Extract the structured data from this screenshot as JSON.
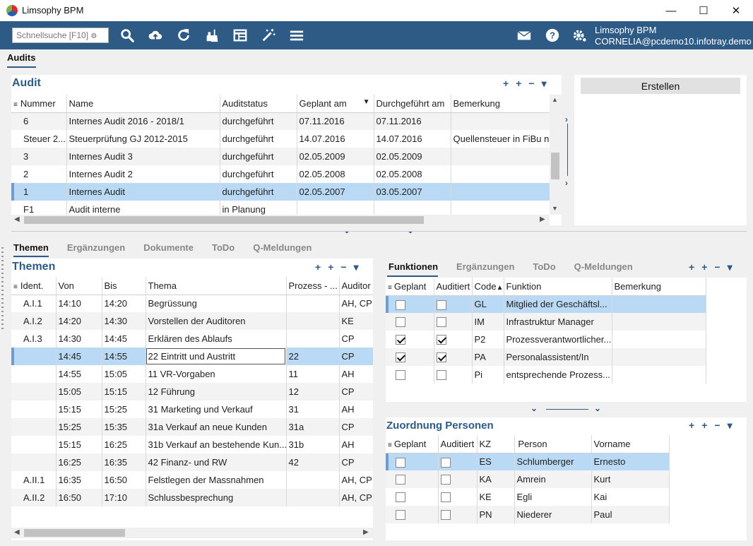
{
  "window": {
    "title": "Limsophy BPM",
    "minimize": "—",
    "maximize": "☐",
    "close": "✕"
  },
  "toolbar": {
    "search_placeholder": "Schnellsuche [F10]",
    "user_app": "Limsophy BPM",
    "user_email": "CORNELIA@pcdemo10.infotray.demo"
  },
  "main_tab": "Audits",
  "audit": {
    "title": "Audit",
    "create_label": "Erstellen",
    "columns": [
      "Nummer",
      "Name",
      "Auditstatus",
      "Geplant am",
      "Durchgeführt am",
      "Bemerkung"
    ],
    "rows": [
      [
        "6",
        "Internes Audit 2016 - 2018/1",
        "durchgeführt",
        "07.11.2016",
        "07.11.2016",
        ""
      ],
      [
        "Steuer 2...",
        "Steuerprüfung GJ 2012-2015",
        "durchgeführt",
        "14.07.2016",
        "14.07.2016",
        "Quellensteuer in FiBu na"
      ],
      [
        "3",
        "Internes Audit 3",
        "durchgeführt",
        "02.05.2009",
        "02.05.2009",
        ""
      ],
      [
        "2",
        "Internes Audit 2",
        "durchgeführt",
        "02.05.2008",
        "02.05.2008",
        ""
      ],
      [
        "1",
        "Internes Audit",
        "durchgeführt",
        "02.05.2007",
        "03.05.2007",
        ""
      ],
      [
        "F1",
        "Audit interne",
        "in Planung",
        "",
        "",
        ""
      ]
    ],
    "selected_row": 4
  },
  "lower_tabs": [
    "Themen",
    "Ergänzungen",
    "Dokumente",
    "ToDo",
    "Q-Meldungen"
  ],
  "themen": {
    "title": "Themen",
    "columns": [
      "Ident.",
      "Von",
      "Bis",
      "Thema",
      "Prozess - ...",
      "Auditor"
    ],
    "rows": [
      [
        "A.I.1",
        "14:10",
        "14:20",
        "Begrüssung",
        "",
        "AH, CP"
      ],
      [
        "A.I.2",
        "14:20",
        "14:30",
        "Vorstellen der Auditoren",
        "",
        "KE"
      ],
      [
        "A.I.3",
        "14:30",
        "14:45",
        "Erklären des Ablaufs",
        "",
        "CP"
      ],
      [
        "",
        "14:45",
        "14:55",
        "22 Eintritt und Austritt",
        "22",
        "CP"
      ],
      [
        "",
        "14:55",
        "15:05",
        "11 VR-Vorgaben",
        "11",
        "AH"
      ],
      [
        "",
        "15:05",
        "15:15",
        "12 Führung",
        "12",
        "CP"
      ],
      [
        "",
        "15:15",
        "15:25",
        "31 Marketing und Verkauf",
        "31",
        "AH"
      ],
      [
        "",
        "15:25",
        "15:35",
        "31a Verkauf an neue Kunden",
        "31a",
        "CP"
      ],
      [
        "",
        "15:15",
        "16:25",
        "31b Verkauf an bestehende Kun...",
        "31b",
        "AH"
      ],
      [
        "",
        "16:25",
        "16:35",
        "42 Finanz- und RW",
        "42",
        "CP"
      ],
      [
        "A.II.1",
        "16:35",
        "16:50",
        "Felstlegen der Massnahmen",
        "",
        "AH, CP"
      ],
      [
        "A.II.2",
        "16:50",
        "17:10",
        "Schlussbesprechung",
        "",
        "AH, CP"
      ]
    ],
    "selected_row": 3
  },
  "right_tabs": [
    "Funktionen",
    "Ergänzungen",
    "ToDo",
    "Q-Meldungen"
  ],
  "funktionen": {
    "columns": [
      "Geplant",
      "Auditiert",
      "Code",
      "Funktion",
      "Bemerkung"
    ],
    "rows": [
      {
        "geplant": false,
        "auditiert": false,
        "code": "GL",
        "funktion": "Mitglied der Geschäftsl...",
        "bem": ""
      },
      {
        "geplant": false,
        "auditiert": false,
        "code": "IM",
        "funktion": "Infrastruktur Manager",
        "bem": ""
      },
      {
        "geplant": true,
        "auditiert": true,
        "code": "P2",
        "funktion": "Prozessverantwortlicher...",
        "bem": ""
      },
      {
        "geplant": true,
        "auditiert": true,
        "code": "PA",
        "funktion": "Personalassistent/In",
        "bem": ""
      },
      {
        "geplant": false,
        "auditiert": false,
        "code": "Pi",
        "funktion": "entsprechende Prozess...",
        "bem": ""
      }
    ],
    "selected_row": 0
  },
  "personen": {
    "title": "Zuordnung Personen",
    "columns": [
      "Geplant",
      "Auditiert",
      "KZ",
      "Person",
      "Vorname"
    ],
    "rows": [
      {
        "geplant": false,
        "auditiert": false,
        "kz": "ES",
        "person": "Schlumberger",
        "vorname": "Ernesto"
      },
      {
        "geplant": false,
        "auditiert": false,
        "kz": "KA",
        "person": "Amrein",
        "vorname": "Kurt"
      },
      {
        "geplant": false,
        "auditiert": false,
        "kz": "KE",
        "person": "Egli",
        "vorname": "Kai"
      },
      {
        "geplant": false,
        "auditiert": false,
        "kz": "PN",
        "person": "Niederer",
        "vorname": "Paul"
      }
    ],
    "selected_row": 0
  },
  "colors": {
    "accent": "#2e5b86",
    "selection": "#b9d9f5"
  }
}
